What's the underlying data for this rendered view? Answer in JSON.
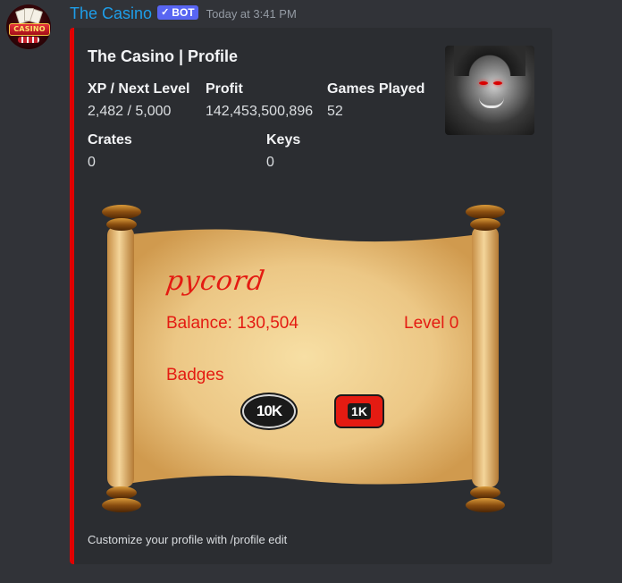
{
  "author": {
    "name": "The Casino",
    "bot_tag": "BOT",
    "timestamp": "Today at 3:41 PM",
    "avatar_icon": "casino-logo-icon",
    "avatar_text": "CASINO"
  },
  "embed": {
    "accent_color": "#e00000",
    "title": "The Casino | Profile",
    "fields": {
      "xp": {
        "name": "XP / Next Level",
        "value": "2,482 / 5,000"
      },
      "profit": {
        "name": "Profit",
        "value": "142,453,500,896"
      },
      "games": {
        "name": "Games Played",
        "value": "52"
      },
      "crates": {
        "name": "Crates",
        "value": "0"
      },
      "keys": {
        "name": "Keys",
        "value": "0"
      }
    },
    "thumbnail_icon": "joker-portrait-icon",
    "image": {
      "username": "pycord",
      "balance": "Balance: 130,504",
      "level": "Level 0",
      "badges_label": "Badges",
      "badges": [
        {
          "label": "10K",
          "icon": "10k-badge-icon"
        },
        {
          "label": "1K",
          "icon": "1k-badge-icon"
        }
      ],
      "text_color": "#e41b12"
    },
    "footer": "Customize your profile with /profile edit"
  }
}
